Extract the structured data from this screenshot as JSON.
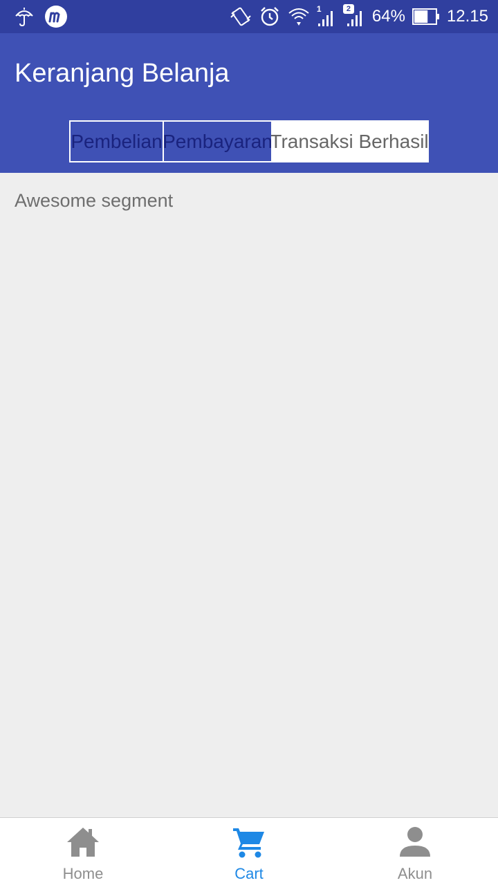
{
  "status_bar": {
    "battery_percent": "64%",
    "time": "12.15",
    "sim1_label": "1",
    "sim2_label": "2",
    "battery_level": 0.64
  },
  "app_bar": {
    "title": "Keranjang Belanja",
    "background_color": "#3f51b5"
  },
  "segment": {
    "options": [
      {
        "label": "Pembelian"
      },
      {
        "label": "Pembayaran"
      },
      {
        "label": "Transaksi Berhasil"
      }
    ]
  },
  "content": {
    "text": "Awesome segment"
  },
  "bottom_nav": {
    "items": [
      {
        "label": "Home",
        "icon": "home-icon",
        "color": "#8e8e8e"
      },
      {
        "label": "Cart",
        "icon": "cart-icon",
        "color": "#1e88e5"
      },
      {
        "label": "Akun",
        "icon": "person-icon",
        "color": "#8e8e8e"
      }
    ],
    "active": "Cart"
  }
}
